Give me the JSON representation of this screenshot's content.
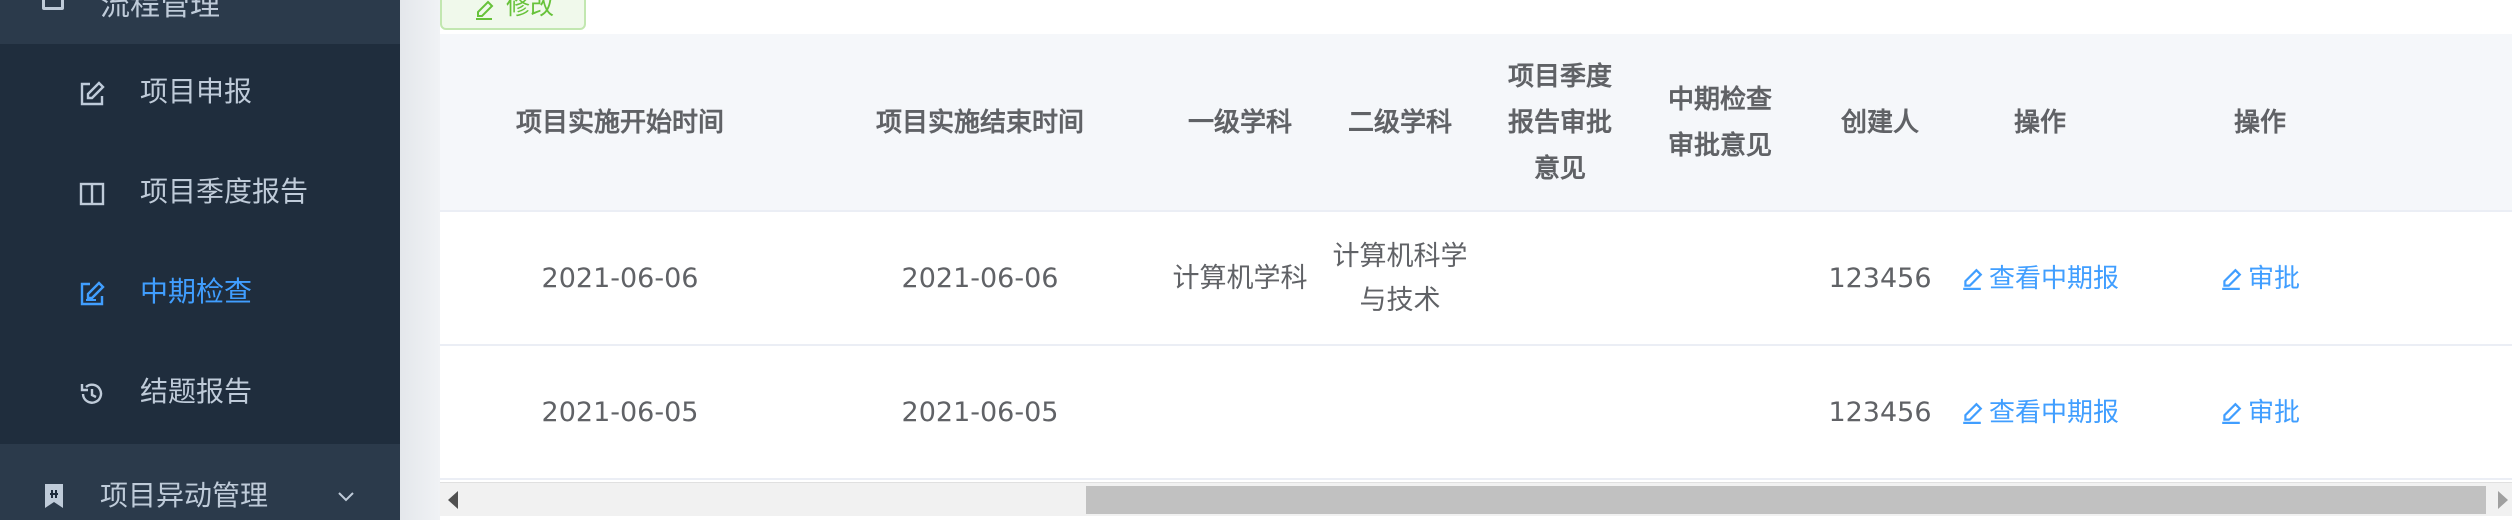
{
  "sidebar": {
    "top_item": {
      "label": "流程管理",
      "icon": "folder-icon"
    },
    "items": [
      {
        "label": "项目申报",
        "icon": "edit-square-icon",
        "active": false
      },
      {
        "label": "项目季度报告",
        "icon": "book-icon",
        "active": false
      },
      {
        "label": "中期检查",
        "icon": "edit-list-icon",
        "active": true
      },
      {
        "label": "结题报告",
        "icon": "history-icon",
        "active": false
      }
    ],
    "group": {
      "label": "项目异动管理",
      "icon": "bookmark-icon",
      "chevron": "chevron-down-icon"
    },
    "colors": {
      "bg": "#1f2d3d",
      "text": "#bfcbd9",
      "active": "#409eff"
    }
  },
  "toolbar": {
    "edit_label": "修改",
    "edit_color": "#67c23a"
  },
  "table": {
    "headers": [
      "项目实施开始时间",
      "项目实施结束时间",
      "一级学科",
      "二级学科",
      "项目季度报告审批意见",
      "中期检查审批意见",
      "创建人",
      "操作",
      "操作"
    ],
    "rows": [
      {
        "start": "2021-06-06",
        "end": "2021-06-06",
        "subject1": "计算机学科",
        "subject2": "计算机科学与技术",
        "quarter_opinion": "",
        "midterm_opinion": "",
        "creator": "123456",
        "action1": "查看中期报",
        "action2": "审批"
      },
      {
        "start": "2021-06-05",
        "end": "2021-06-05",
        "subject1": "",
        "subject2": "",
        "quarter_opinion": "",
        "midterm_opinion": "",
        "creator": "123456",
        "action1": "查看中期报",
        "action2": "审批"
      }
    ]
  }
}
